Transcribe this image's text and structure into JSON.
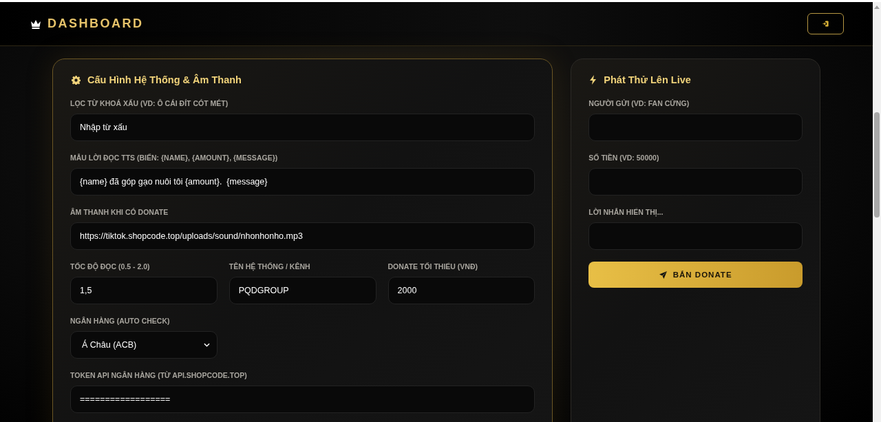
{
  "header": {
    "title": "DASHBOARD"
  },
  "config_panel": {
    "title": "Cấu Hình Hệ Thống & Âm Thanh",
    "rows": [
      [
        {
          "kind": "text",
          "label": "LỌC TỪ KHOÁ XẤU (VD: Ô CÁI ĐÍT CÓT MÉT)",
          "value": "Nhập từ xấu"
        }
      ],
      [
        {
          "kind": "text",
          "label": "MẪU LỜI ĐỌC TTS (BIẾN: {NAME}, {AMOUNT}, {MESSAGE})",
          "value": "{name} đã góp gạo nuôi tôi {amount}.  {message}"
        }
      ],
      [
        {
          "kind": "text",
          "label": "ÂM THANH KHI CÓ DONATE",
          "value": "https://tiktok.shopcode.top/uploads/sound/nhonhonho.mp3"
        }
      ],
      [
        {
          "kind": "text",
          "label": "TỐC ĐỘ ĐỌC (0.5 - 2.0)",
          "value": "1,5"
        },
        {
          "kind": "text",
          "label": "TÊN HỆ THỐNG / KÊNH",
          "value": "PQDGROUP"
        },
        {
          "kind": "text",
          "label": "DONATE TỐI THIỂU (VNĐ)",
          "value": "2000"
        }
      ],
      [
        {
          "kind": "select",
          "label": "NGÂN HÀNG (AUTO CHECK)",
          "value": "Á Châu (ACB)"
        }
      ],
      [
        {
          "kind": "text",
          "label": "TOKEN API NGÂN HÀNG (TỪ API.SHOPCODE.TOP)",
          "value": "=================="
        }
      ]
    ]
  },
  "test_panel": {
    "title": "Phát Thử Lên Live",
    "fields": [
      {
        "label": "NGƯỜI GỬI (VD: FAN CỨNG)"
      },
      {
        "label": "SỐ TIỀN (VD: 50000)"
      },
      {
        "label": "LỜI NHẮN HIỂN THỊ..."
      }
    ],
    "button": {
      "label": "BẮN DONATE"
    }
  }
}
